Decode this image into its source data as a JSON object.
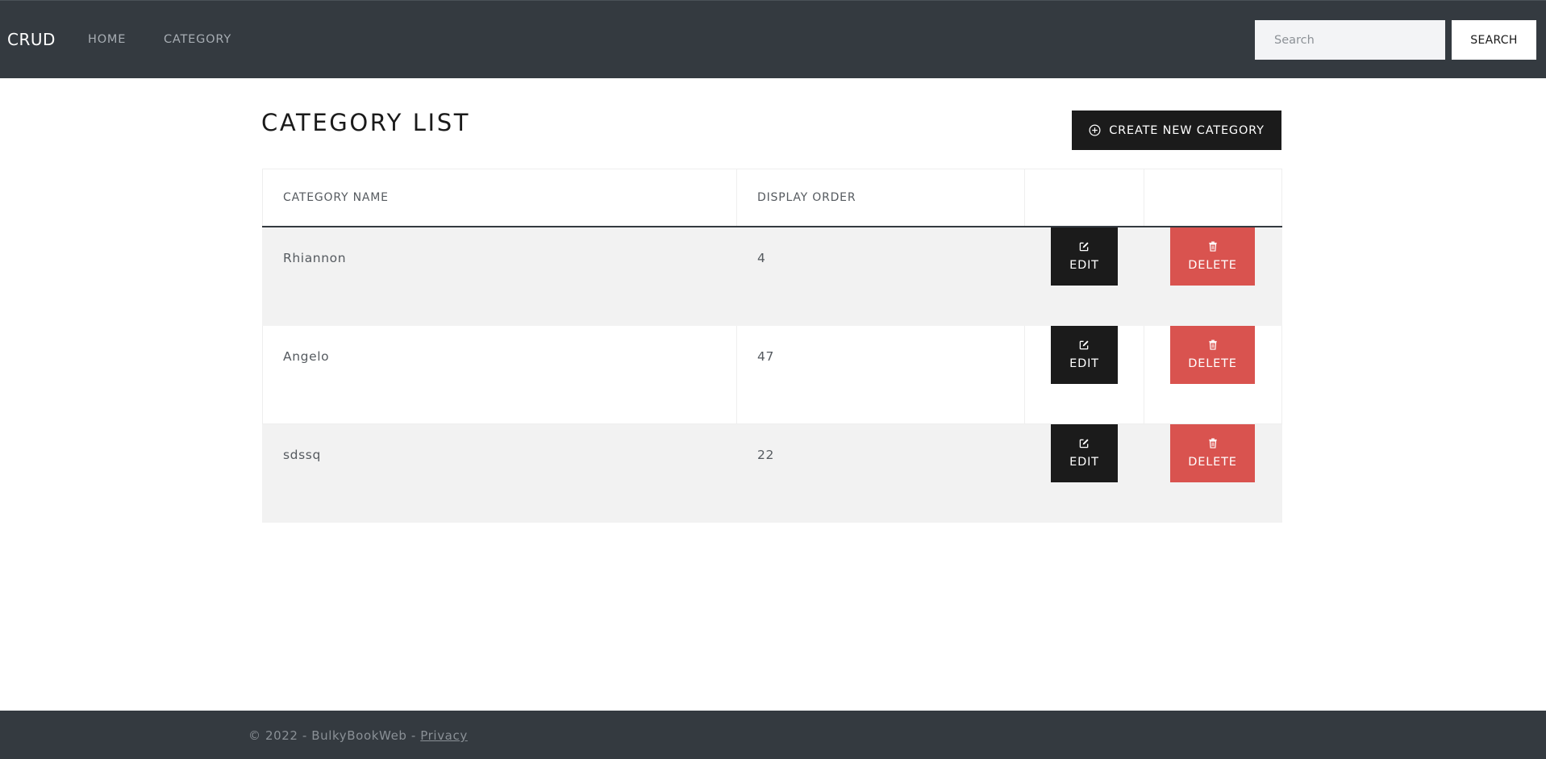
{
  "navbar": {
    "brand": "CRUD",
    "links": [
      "HOME",
      "CATEGORY"
    ],
    "search_placeholder": "Search",
    "search_button": "SEARCH"
  },
  "main": {
    "title": "CATEGORY LIST",
    "create_button": "CREATE NEW CATEGORY",
    "create_icon": "plus-circle-icon",
    "table": {
      "headers": [
        "CATEGORY NAME",
        "DISPLAY ORDER",
        "",
        ""
      ],
      "rows": [
        {
          "name": "Rhiannon",
          "order": "4"
        },
        {
          "name": "Angelo",
          "order": "47"
        },
        {
          "name": "sdssq",
          "order": "22"
        }
      ],
      "edit_label": "EDIT",
      "delete_label": "DELETE",
      "edit_icon": "edit-icon",
      "delete_icon": "trash-icon"
    }
  },
  "footer": {
    "text": "© 2022 - BulkyBookWeb - ",
    "privacy_link": "Privacy"
  },
  "colors": {
    "navbar": "#343a40",
    "primary_button": "#1b1b1b",
    "danger_button": "#d9534f",
    "stripe": "#f2f2f2"
  }
}
